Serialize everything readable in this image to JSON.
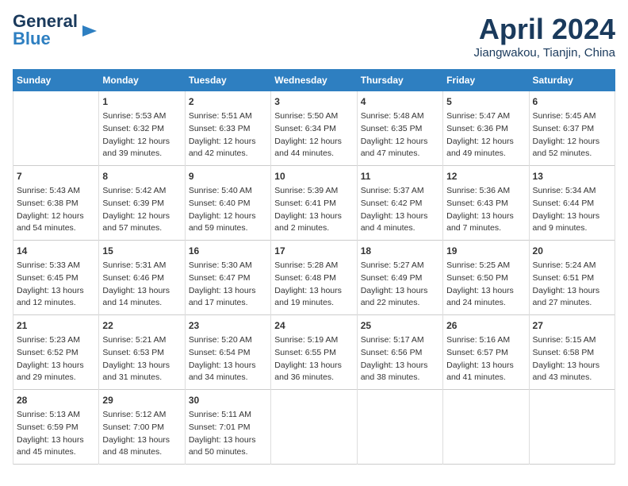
{
  "header": {
    "logo_general": "General",
    "logo_blue": "Blue",
    "title": "April 2024",
    "subtitle": "Jiangwakou, Tianjin, China"
  },
  "weekdays": [
    "Sunday",
    "Monday",
    "Tuesday",
    "Wednesday",
    "Thursday",
    "Friday",
    "Saturday"
  ],
  "weeks": [
    [
      {
        "day": "",
        "info": ""
      },
      {
        "day": "1",
        "info": "Sunrise: 5:53 AM\nSunset: 6:32 PM\nDaylight: 12 hours\nand 39 minutes."
      },
      {
        "day": "2",
        "info": "Sunrise: 5:51 AM\nSunset: 6:33 PM\nDaylight: 12 hours\nand 42 minutes."
      },
      {
        "day": "3",
        "info": "Sunrise: 5:50 AM\nSunset: 6:34 PM\nDaylight: 12 hours\nand 44 minutes."
      },
      {
        "day": "4",
        "info": "Sunrise: 5:48 AM\nSunset: 6:35 PM\nDaylight: 12 hours\nand 47 minutes."
      },
      {
        "day": "5",
        "info": "Sunrise: 5:47 AM\nSunset: 6:36 PM\nDaylight: 12 hours\nand 49 minutes."
      },
      {
        "day": "6",
        "info": "Sunrise: 5:45 AM\nSunset: 6:37 PM\nDaylight: 12 hours\nand 52 minutes."
      }
    ],
    [
      {
        "day": "7",
        "info": "Sunrise: 5:43 AM\nSunset: 6:38 PM\nDaylight: 12 hours\nand 54 minutes."
      },
      {
        "day": "8",
        "info": "Sunrise: 5:42 AM\nSunset: 6:39 PM\nDaylight: 12 hours\nand 57 minutes."
      },
      {
        "day": "9",
        "info": "Sunrise: 5:40 AM\nSunset: 6:40 PM\nDaylight: 12 hours\nand 59 minutes."
      },
      {
        "day": "10",
        "info": "Sunrise: 5:39 AM\nSunset: 6:41 PM\nDaylight: 13 hours\nand 2 minutes."
      },
      {
        "day": "11",
        "info": "Sunrise: 5:37 AM\nSunset: 6:42 PM\nDaylight: 13 hours\nand 4 minutes."
      },
      {
        "day": "12",
        "info": "Sunrise: 5:36 AM\nSunset: 6:43 PM\nDaylight: 13 hours\nand 7 minutes."
      },
      {
        "day": "13",
        "info": "Sunrise: 5:34 AM\nSunset: 6:44 PM\nDaylight: 13 hours\nand 9 minutes."
      }
    ],
    [
      {
        "day": "14",
        "info": "Sunrise: 5:33 AM\nSunset: 6:45 PM\nDaylight: 13 hours\nand 12 minutes."
      },
      {
        "day": "15",
        "info": "Sunrise: 5:31 AM\nSunset: 6:46 PM\nDaylight: 13 hours\nand 14 minutes."
      },
      {
        "day": "16",
        "info": "Sunrise: 5:30 AM\nSunset: 6:47 PM\nDaylight: 13 hours\nand 17 minutes."
      },
      {
        "day": "17",
        "info": "Sunrise: 5:28 AM\nSunset: 6:48 PM\nDaylight: 13 hours\nand 19 minutes."
      },
      {
        "day": "18",
        "info": "Sunrise: 5:27 AM\nSunset: 6:49 PM\nDaylight: 13 hours\nand 22 minutes."
      },
      {
        "day": "19",
        "info": "Sunrise: 5:25 AM\nSunset: 6:50 PM\nDaylight: 13 hours\nand 24 minutes."
      },
      {
        "day": "20",
        "info": "Sunrise: 5:24 AM\nSunset: 6:51 PM\nDaylight: 13 hours\nand 27 minutes."
      }
    ],
    [
      {
        "day": "21",
        "info": "Sunrise: 5:23 AM\nSunset: 6:52 PM\nDaylight: 13 hours\nand 29 minutes."
      },
      {
        "day": "22",
        "info": "Sunrise: 5:21 AM\nSunset: 6:53 PM\nDaylight: 13 hours\nand 31 minutes."
      },
      {
        "day": "23",
        "info": "Sunrise: 5:20 AM\nSunset: 6:54 PM\nDaylight: 13 hours\nand 34 minutes."
      },
      {
        "day": "24",
        "info": "Sunrise: 5:19 AM\nSunset: 6:55 PM\nDaylight: 13 hours\nand 36 minutes."
      },
      {
        "day": "25",
        "info": "Sunrise: 5:17 AM\nSunset: 6:56 PM\nDaylight: 13 hours\nand 38 minutes."
      },
      {
        "day": "26",
        "info": "Sunrise: 5:16 AM\nSunset: 6:57 PM\nDaylight: 13 hours\nand 41 minutes."
      },
      {
        "day": "27",
        "info": "Sunrise: 5:15 AM\nSunset: 6:58 PM\nDaylight: 13 hours\nand 43 minutes."
      }
    ],
    [
      {
        "day": "28",
        "info": "Sunrise: 5:13 AM\nSunset: 6:59 PM\nDaylight: 13 hours\nand 45 minutes."
      },
      {
        "day": "29",
        "info": "Sunrise: 5:12 AM\nSunset: 7:00 PM\nDaylight: 13 hours\nand 48 minutes."
      },
      {
        "day": "30",
        "info": "Sunrise: 5:11 AM\nSunset: 7:01 PM\nDaylight: 13 hours\nand 50 minutes."
      },
      {
        "day": "",
        "info": ""
      },
      {
        "day": "",
        "info": ""
      },
      {
        "day": "",
        "info": ""
      },
      {
        "day": "",
        "info": ""
      }
    ]
  ]
}
